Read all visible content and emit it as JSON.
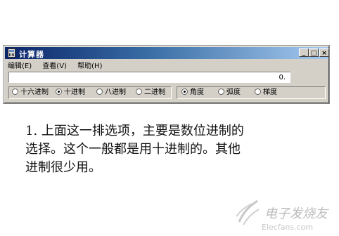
{
  "window": {
    "title": "计算器",
    "minimize_glyph": "_",
    "maximize_glyph": "□",
    "close_glyph": "×"
  },
  "menu": {
    "edit": "编辑(E)",
    "view": "查看(V)",
    "help": "帮助(H)"
  },
  "display": {
    "value": "0."
  },
  "base_options": {
    "hex": "十六进制",
    "dec": "十进制",
    "oct": "八进制",
    "bin": "二进制",
    "selected": "十进制"
  },
  "angle_options": {
    "deg": "角度",
    "rad": "弧度",
    "grad": "梯度",
    "selected": "角度"
  },
  "caption": {
    "line1": "1. 上面这一排选项，主要是数位进制的",
    "line2": "选择。这个一般都是用十进制的。其他",
    "line3": "进制很少用。"
  },
  "watermark": {
    "main": "电子发烧友",
    "sub": "Elecfans.com"
  },
  "colors": {
    "window_face": "#d4d0c8",
    "titlebar_start": "#0a246a",
    "titlebar_end": "#a6caf0",
    "watermark": "#bdbdbd"
  }
}
